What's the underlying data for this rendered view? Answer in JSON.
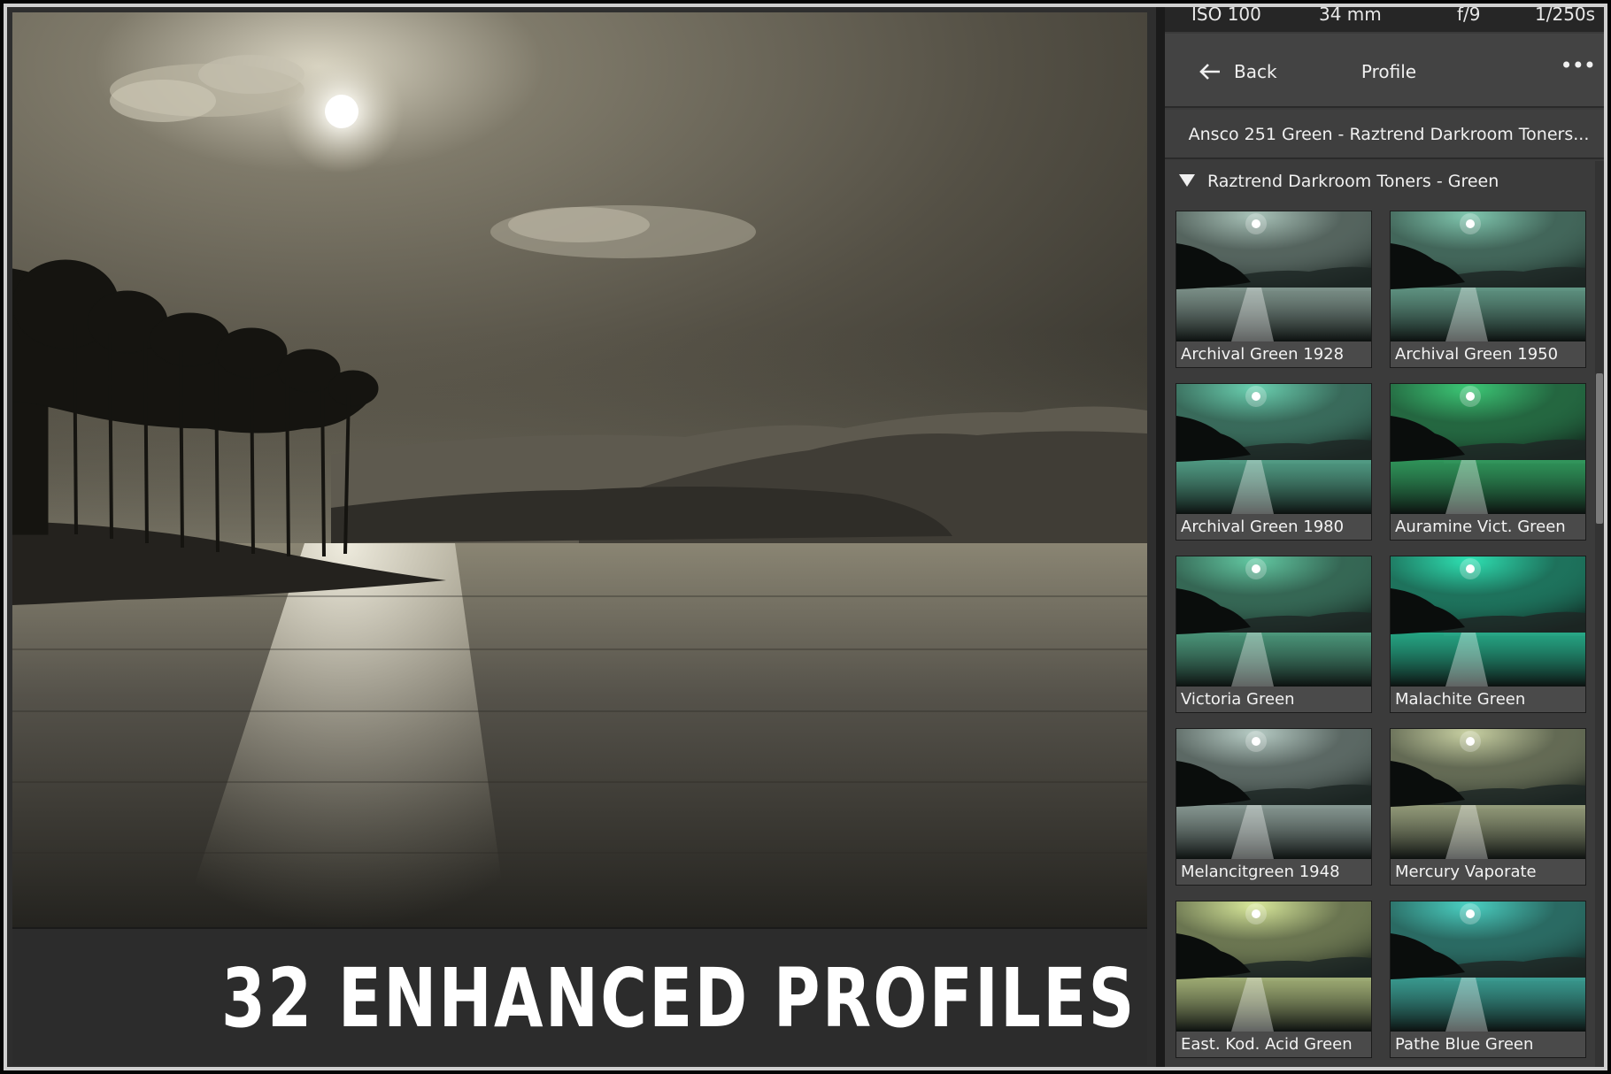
{
  "meta": {
    "iso": "ISO 100",
    "focal": "34 mm",
    "aperture": "f/9",
    "shutter": "1/250s"
  },
  "profile_panel": {
    "back_label": "Back",
    "title": "Profile",
    "more_label": "•••",
    "selected_profile": "Ansco 251 Green - Raztrend Darkroom Toners...",
    "group_name": "Raztrend Darkroom Toners - Green"
  },
  "profiles": [
    {
      "label": "Archival Green 1928",
      "tint": "#a8c2b8"
    },
    {
      "label": "Archival Green 1950",
      "tint": "#7fc6ae"
    },
    {
      "label": "Archival Green 1980",
      "tint": "#6ad0b0"
    },
    {
      "label": "Auramine Vict. Green",
      "tint": "#3cc876"
    },
    {
      "label": "Victoria Green",
      "tint": "#62c8a2"
    },
    {
      "label": "Malachite Green",
      "tint": "#2ee0b2"
    },
    {
      "label": "Melancitgreen 1948",
      "tint": "#b6cbc4"
    },
    {
      "label": "Mercury Vaporate",
      "tint": "#c8d0a2"
    },
    {
      "label": "East. Kod. Acid Green",
      "tint": "#d8e89a"
    },
    {
      "label": "Pathe Blue Green",
      "tint": "#4ad0c2"
    }
  ],
  "banner": {
    "text": "32 ENHANCED PROFILES"
  },
  "colors": {
    "panel_bg": "#3b3b3b",
    "photo_tone": "#c9c2ad"
  }
}
